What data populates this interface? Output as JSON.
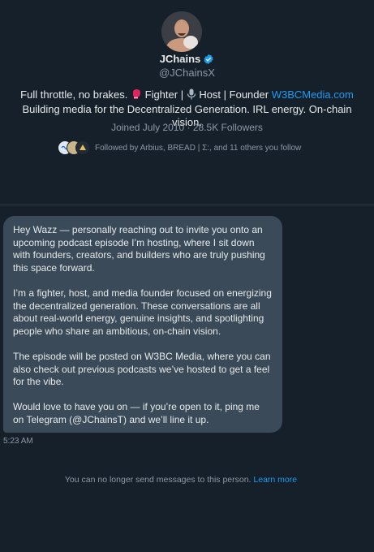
{
  "profile": {
    "display_name": "JChains",
    "handle": "@JChainsX",
    "bio_part1": "Full throttle, no brakes. ",
    "bio_part2": " Fighter | ",
    "bio_part3": " Host | Founder ",
    "bio_link": "W3BCMedia.com",
    "bio_line2": "Building media for the Decentralized Generation. IRL energy. On-chain vision.",
    "joined": "Joined July 2010",
    "separator": "·",
    "followers": "28.5K Followers",
    "followed_by": "Followed by Arbius, BREAD | Σ:, and 11 others you follow",
    "icons": {
      "verified": "verified-badge-icon",
      "glove": "boxing-glove-icon",
      "mic": "microphone-icon"
    }
  },
  "message": {
    "paragraphs": [
      "Hey Wazz — personally reaching out to invite you onto an upcoming podcast episode I’m hosting, where I sit down with founders, creators, and builders who are truly pushing this space forward.",
      "I’m a fighter, host, and media founder focused on energizing the decentralized generation. These conversations are all about real-world energy, genuine insights, and spotlighting people who share an ambitious, on-chain vision.",
      "The episode will be posted on W3BC Media, where you can also check out previous podcasts we’ve hosted to get a feel for the vibe.",
      "Would love to have you on — if you’re open to it, ping me on Telegram (@JChainsT) and we’ll line it up."
    ],
    "time": "5:23 AM"
  },
  "footer": {
    "notice": "You can no longer send messages to this person. ",
    "learn_more": "Learn more"
  },
  "colors": {
    "background": "#15202b",
    "bubble": "#3a4a59",
    "accent": "#1d9bf0",
    "muted": "#8b98a5"
  }
}
